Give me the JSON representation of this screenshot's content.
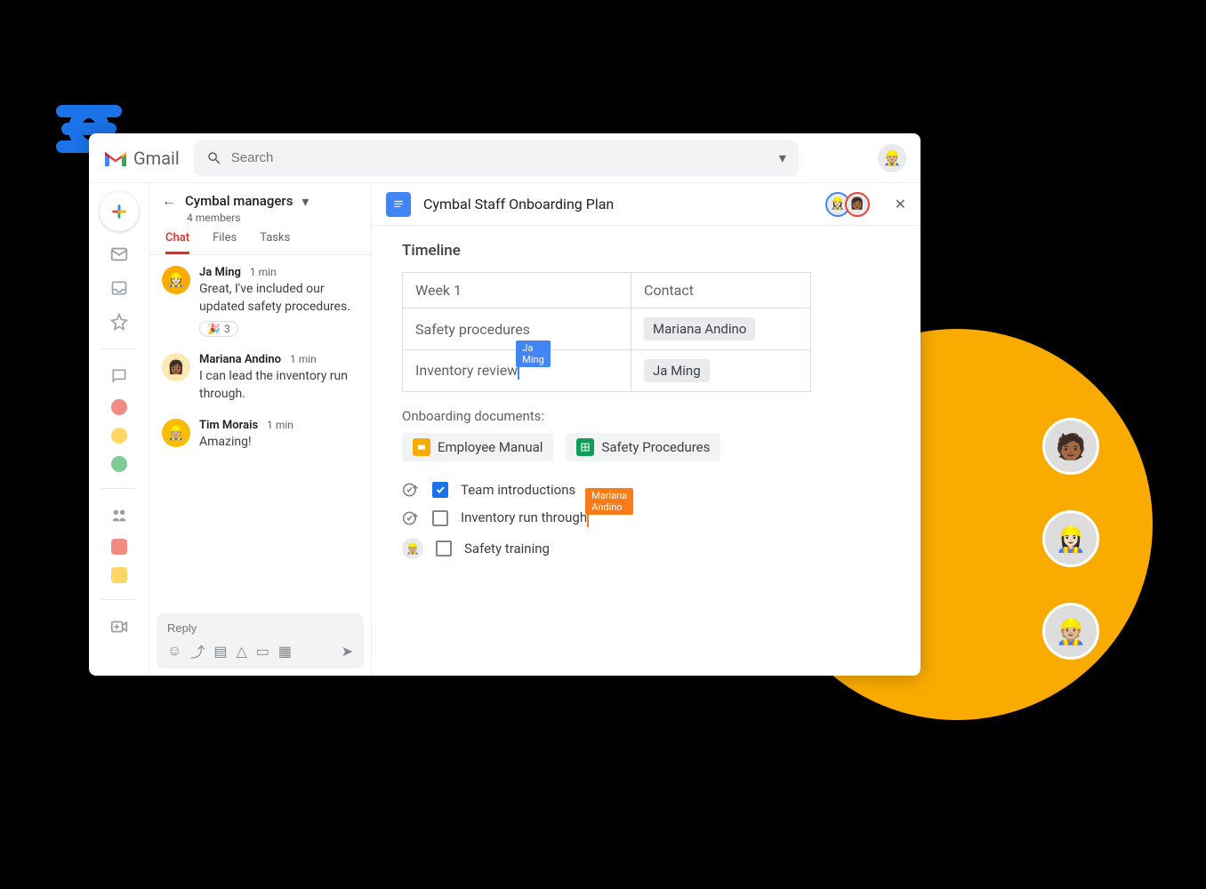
{
  "header": {
    "product": "Gmail",
    "search_placeholder": "Search"
  },
  "chat": {
    "space_name": "Cymbal managers",
    "members_text": "4 members",
    "tabs": [
      "Chat",
      "Files",
      "Tasks"
    ],
    "active_tab": "Chat",
    "messages": [
      {
        "author": "Ja Ming",
        "time": "1 min",
        "text": "Great, I've included our updated safety procedures.",
        "reaction": {
          "emoji": "🎉",
          "count": "3"
        }
      },
      {
        "author": "Mariana Andino",
        "time": "1 min",
        "text": "I can lead the inventory run through."
      },
      {
        "author": "Tim Morais",
        "time": "1 min",
        "text": "Amazing!"
      }
    ],
    "reply_placeholder": "Reply"
  },
  "doc": {
    "title": "Cymbal Staff Onboarding Plan",
    "timeline_heading": "Timeline",
    "table": {
      "headers": [
        "Week 1",
        "Contact"
      ],
      "rows": [
        {
          "topic": "Safety procedures",
          "contact": "Mariana Andino"
        },
        {
          "topic": "Inventory review",
          "contact": "Ja Ming",
          "cursor_user": "Ja Ming"
        }
      ]
    },
    "docs_label": "Onboarding documents:",
    "attachments": [
      {
        "name": "Employee Manual",
        "type": "slides"
      },
      {
        "name": "Safety Procedures",
        "type": "sheets"
      }
    ],
    "tasks": [
      {
        "label": "Team introductions",
        "checked": true,
        "leading": "add"
      },
      {
        "label": "Inventory run through",
        "checked": false,
        "leading": "add",
        "cursor_user": "Mariana Andino"
      },
      {
        "label": "Safety training",
        "checked": false,
        "leading": "avatar"
      }
    ]
  },
  "colors": {
    "accent": "#f9ab00",
    "blue": "#4285f4",
    "red": "#d93025",
    "green": "#0f9d58",
    "orange": "#fa7b17"
  }
}
